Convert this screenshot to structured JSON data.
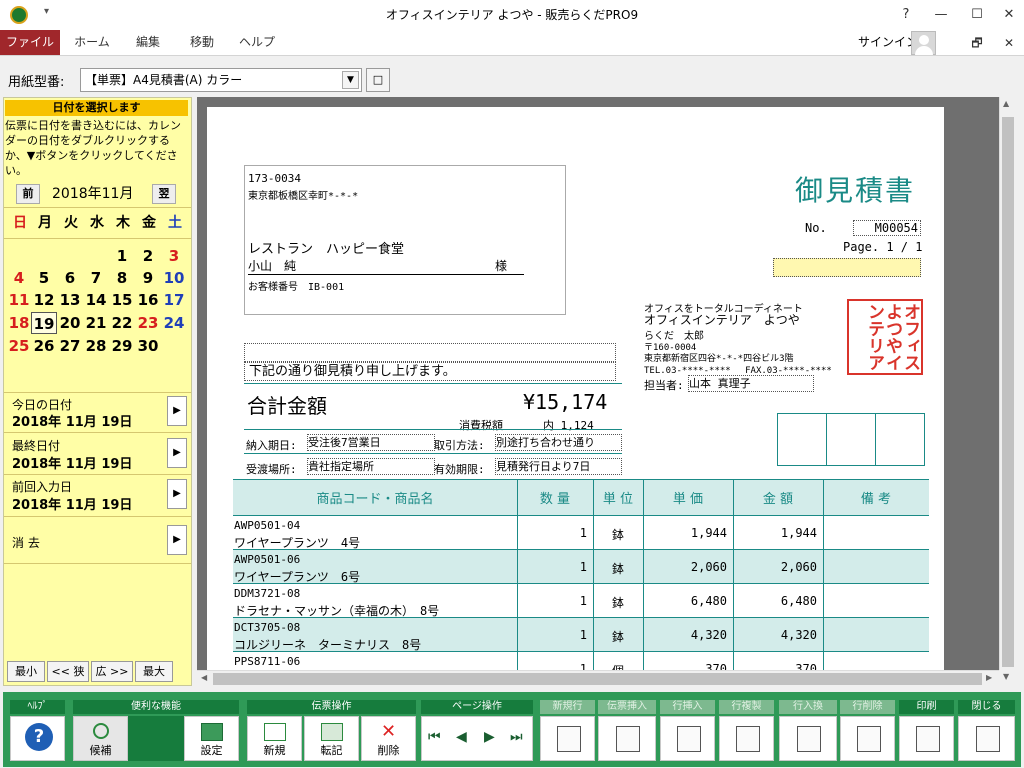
{
  "window": {
    "title": "オフィスインテリア よつや - 販売らくだPRO9",
    "help": "?",
    "minimize": "—",
    "maximize": "☐",
    "close": "✕",
    "restore": "🗗"
  },
  "ribbon": {
    "tabs": [
      "ファイル",
      "ホーム",
      "編集",
      "移動",
      "ヘルプ"
    ],
    "signin": "サインイン"
  },
  "paper": {
    "label": "用紙型番:",
    "value": "【単票】A4見積書(A) カラー",
    "button": "□"
  },
  "sidebar": {
    "header": "日付を選択します",
    "help": "伝票に日付を書き込むには、カレンダーの日付をダブルクリックするか、▼ボタンをクリックしてください。",
    "prev": "前",
    "next": "翌",
    "month": "2018年11月",
    "weekdays": [
      "日",
      "月",
      "火",
      "水",
      "木",
      "金",
      "土"
    ],
    "weeks": [
      [
        "",
        "",
        "",
        "",
        "1",
        "2",
        "3"
      ],
      [
        "4",
        "5",
        "6",
        "7",
        "8",
        "9",
        "10"
      ],
      [
        "11",
        "12",
        "13",
        "14",
        "15",
        "16",
        "17"
      ],
      [
        "18",
        "19",
        "20",
        "21",
        "22",
        "23",
        "24"
      ],
      [
        "25",
        "26",
        "27",
        "28",
        "29",
        "30",
        ""
      ]
    ],
    "today_label": "今日の日付",
    "today_value": "2018年 11月 19日",
    "last_label": "最終日付",
    "last_value": "2018年 11月 19日",
    "prev_label": "前回入力日",
    "prev_value": "2018年 11月 19日",
    "clear_label": "消 去",
    "arrow": "▶",
    "zoom": [
      "最小",
      "<< 狭",
      "広 >>",
      "最大"
    ]
  },
  "doc": {
    "title": "御見積書",
    "zip": "173-0034",
    "address": "東京都板橋区幸町*-*-*",
    "customer": "レストラン　ハッピー食堂",
    "contact": "小山　純",
    "honorific": "様",
    "customer_no": "お客様番号　IB-001",
    "no_label": "No.",
    "no_value": "M00054",
    "page": "Page. 1 / 1",
    "intro": "下記の通り御見積り申し上げます。",
    "total_label": "合計金額",
    "total_value": "¥15,174",
    "tax_label": "消費税額",
    "tax_value": "内 1,124",
    "company_slogan": "オフィスをトータルコーディネート",
    "company_name": "オフィスインテリア　よつや",
    "company_person": "らくだ　太郎",
    "company_zip": "〒160-0004",
    "company_address": "東京都新宿区四谷*-*-*四谷ビル3階",
    "company_phone": "TEL.03-****-****　 FAX.03-****-****",
    "staff_label": "担当者:",
    "staff_value": "山本 真理子",
    "stamp": "オフィスよつやインテリア",
    "delivery_label": "納入期日:",
    "delivery_value": "受注後7営業日",
    "payment_label": "取引方法:",
    "payment_value": "別途打ち合わせ通り",
    "place_label": "受渡場所:",
    "place_value": "貴社指定場所",
    "valid_label": "有効期限:",
    "valid_value": "見積発行日より7日",
    "headers": [
      "商品コード・商品名",
      "数 量",
      "単 位",
      "単 価",
      "金 額",
      "備 考"
    ],
    "rows": [
      {
        "code": "AWP0501-04",
        "name": "ワイヤープランツ　4号",
        "qty": "1",
        "unit": "鉢",
        "price": "1,944",
        "amount": "1,944"
      },
      {
        "code": "AWP0501-06",
        "name": "ワイヤープランツ　6号",
        "qty": "1",
        "unit": "鉢",
        "price": "2,060",
        "amount": "2,060"
      },
      {
        "code": "DDM3721-08",
        "name": "ドラセナ・マッサン（幸福の木）　8号",
        "qty": "1",
        "unit": "鉢",
        "price": "6,480",
        "amount": "6,480"
      },
      {
        "code": "DCT3705-08",
        "name": "コルジリーネ　ターミナリス　8号",
        "qty": "1",
        "unit": "鉢",
        "price": "4,320",
        "amount": "4,320"
      },
      {
        "code": "PPS8711-06",
        "name": "",
        "qty": "1",
        "unit": "個",
        "price": "370",
        "amount": "370"
      }
    ]
  },
  "toolbar": {
    "groups": [
      "ﾍﾙﾌﾟ",
      "便利な機能",
      "伝票操作",
      "ページ操作",
      "新規行",
      "伝票挿入",
      "行挿入",
      "行複製",
      "行入換",
      "行削除",
      "印刷",
      "閉じる"
    ],
    "help": "?",
    "candidate": "候補",
    "settings": "設定",
    "new": "新規",
    "transfer": "転記",
    "delete": "削除"
  },
  "colors": {
    "file_tab": "#a0272b",
    "sidebar": "#fffea6",
    "header_bar": "#f7c200",
    "teal": "#1a8a86",
    "table_head": "#d3ecea",
    "toolbar": "#2f9a57",
    "stamp": "#d9342b"
  }
}
